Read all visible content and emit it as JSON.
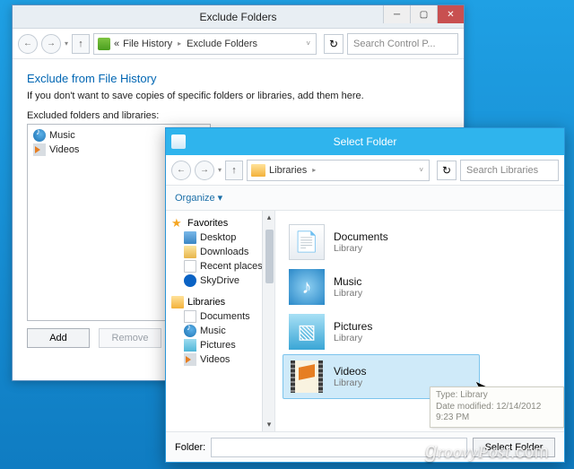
{
  "watermark": "groovyPost.com",
  "win1": {
    "title": "Exclude Folders",
    "breadcrumb": {
      "a": "File History",
      "b": "Exclude Folders"
    },
    "search_ph": "Search Control P...",
    "heading": "Exclude from File History",
    "desc": "If you don't want to save copies of specific folders or libraries, add them here.",
    "list_label": "Excluded folders and libraries:",
    "items": [
      {
        "label": "Music",
        "icon": "ic-music"
      },
      {
        "label": "Videos",
        "icon": "ic-video"
      }
    ],
    "add": "Add",
    "remove": "Remove"
  },
  "win2": {
    "title": "Select Folder",
    "path": "Libraries",
    "search_ph": "Search Libraries",
    "organize": "Organize",
    "sidebar": {
      "favorites": "Favorites",
      "fav_items": [
        {
          "label": "Desktop",
          "cls": "si-desktop"
        },
        {
          "label": "Downloads",
          "cls": "si-dl"
        },
        {
          "label": "Recent places",
          "cls": "si-recent"
        },
        {
          "label": "SkyDrive",
          "cls": "si-sky"
        }
      ],
      "libraries": "Libraries",
      "lib_items": [
        {
          "label": "Documents",
          "cls": "si-doc"
        },
        {
          "label": "Music",
          "cls": "ic-music"
        },
        {
          "label": "Pictures",
          "cls": "si-pic"
        },
        {
          "label": "Videos",
          "cls": "ic-video"
        }
      ]
    },
    "libs": [
      {
        "name": "Documents",
        "sub": "Library",
        "cls": "lib-docs",
        "glyph": "📄"
      },
      {
        "name": "Music",
        "sub": "Library",
        "cls": "lib-music",
        "glyph": "♪"
      },
      {
        "name": "Pictures",
        "sub": "Library",
        "cls": "lib-pics",
        "glyph": "▧"
      },
      {
        "name": "Videos",
        "sub": "Library",
        "cls": "lib-videos",
        "glyph": ""
      }
    ],
    "tooltip": {
      "l1": "Type: Library",
      "l2": "Date modified: 12/14/2012 9:23 PM"
    },
    "folder_label": "Folder:",
    "select_btn": "Select Folder"
  }
}
